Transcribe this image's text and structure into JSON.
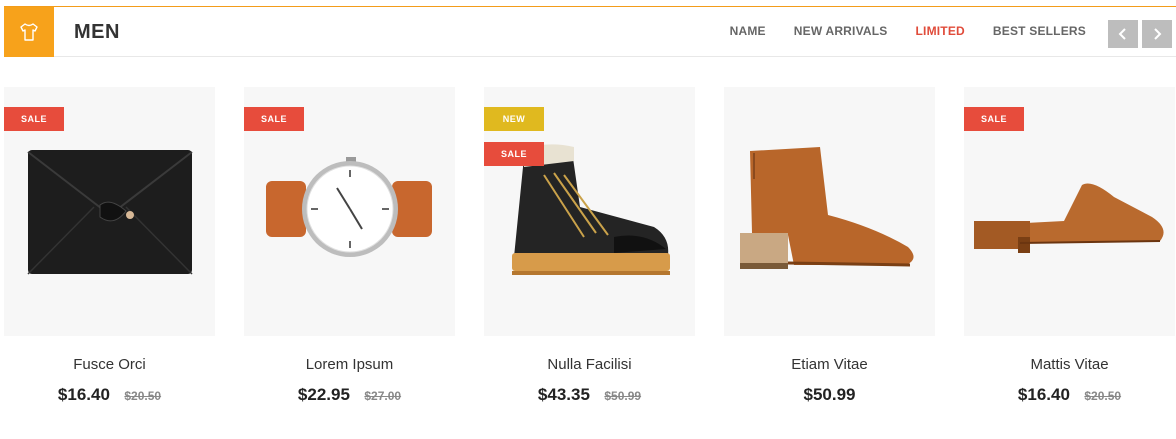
{
  "category": {
    "title": "MEN",
    "icon": "shirt-icon"
  },
  "tabs": [
    {
      "label": "NAME",
      "active": false
    },
    {
      "label": "NEW ARRIVALS",
      "active": false
    },
    {
      "label": "LIMITED",
      "active": true
    },
    {
      "label": "BEST SELLERS",
      "active": false
    }
  ],
  "nav": {
    "prev_icon": "chevron-left-icon",
    "next_icon": "chevron-right-icon"
  },
  "colors": {
    "accent": "#f7a21b",
    "active_tab": "#e04b3a",
    "sale_badge": "#e74c3c",
    "new_badge": "#e0b91f"
  },
  "products": [
    {
      "name": "Fusce Orci",
      "price": "$16.40",
      "old_price": "$20.50",
      "badges": [
        "SALE"
      ],
      "image": "black-clutch-bag"
    },
    {
      "name": "Lorem Ipsum",
      "price": "$22.95",
      "old_price": "$27.00",
      "badges": [
        "SALE"
      ],
      "image": "wrist-watch"
    },
    {
      "name": "Nulla Facilisi",
      "price": "$43.35",
      "old_price": "$50.99",
      "badges": [
        "NEW",
        "SALE"
      ],
      "image": "hiking-boot"
    },
    {
      "name": "Etiam Vitae",
      "price": "$50.99",
      "old_price": "",
      "badges": [],
      "image": "ankle-boot"
    },
    {
      "name": "Mattis Vitae",
      "price": "$16.40",
      "old_price": "$20.50",
      "badges": [
        "SALE"
      ],
      "image": "mule-shoe"
    }
  ]
}
